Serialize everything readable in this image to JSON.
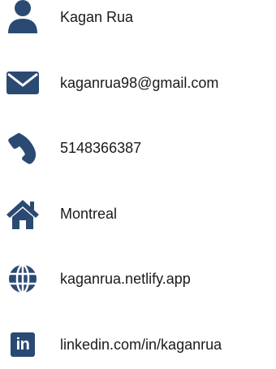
{
  "theme": {
    "icon_color": "#2b4a73",
    "text_color": "#1a1a1a",
    "background": "#ffffff"
  },
  "contacts": [
    {
      "icon": "user-icon",
      "text": "Kagan Rua"
    },
    {
      "icon": "envelope-icon",
      "text": "kaganrua98@gmail.com"
    },
    {
      "icon": "phone-icon",
      "text": "5148366387"
    },
    {
      "icon": "home-icon",
      "text": "Montreal"
    },
    {
      "icon": "globe-icon",
      "text": "kaganrua.netlify.app"
    },
    {
      "icon": "linkedin-icon",
      "text": "linkedin.com/in/kaganrua",
      "icon_text": "in"
    }
  ]
}
